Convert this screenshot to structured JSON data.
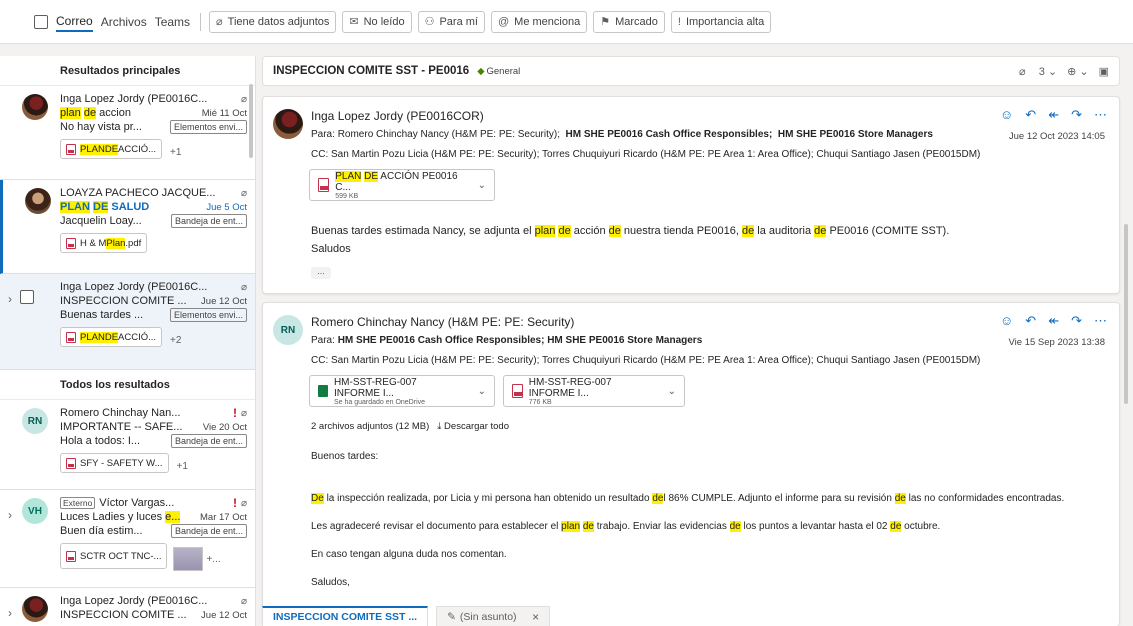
{
  "filterbar": {
    "tabs": [
      "Correo",
      "Archivos",
      "Teams"
    ],
    "chips": [
      {
        "icon": "paperclip-icon",
        "glyph": "⌀",
        "label": "Tiene datos adjuntos"
      },
      {
        "icon": "unread-mail-icon",
        "glyph": "✉",
        "label": "No leído"
      },
      {
        "icon": "person-icon",
        "glyph": "⚇",
        "label": "Para mí"
      },
      {
        "icon": "at-mention-icon",
        "glyph": "@",
        "label": "Me menciona"
      },
      {
        "icon": "flag-icon",
        "glyph": "⚑",
        "label": "Marcado"
      },
      {
        "icon": "importance-icon",
        "glyph": "!",
        "label": "Importancia alta"
      }
    ]
  },
  "list": {
    "top_header": "Resultados principales",
    "all_header": "Todos los resultados",
    "items": [
      {
        "sender": "Inga Lopez Jordy (PE0016C...",
        "subj_a": "plan",
        "subj_b": " ",
        "subj_c": "de",
        "subj_d": " accion",
        "date": "Mié 11 Oct",
        "preview": "No hay vista pr...",
        "folder": "Elementos envi...",
        "att_a": "PLAN",
        "att_b": " ",
        "att_c": "DE",
        "att_d": " ACCIÓ...",
        "more": "+1"
      },
      {
        "sender": "LOAYZA PACHECO JACQUE...",
        "subj_a": "PLAN",
        "subj_b": " ",
        "subj_c": "DE",
        "subj_d": " SALUD",
        "date": "Jue 5 Oct",
        "preview": "Jacquelin Loay...",
        "folder": "Bandeja de ent...",
        "att_a": "H & M ",
        "att_b": "Plan",
        "att_c": ".pdf"
      },
      {
        "sender": "Inga Lopez Jordy (PE0016C...",
        "subject": "INSPECCION COMITE ...",
        "date": "Jue 12 Oct",
        "preview": "Buenas tardes ...",
        "folder": "Elementos envi...",
        "att_a": "PLAN",
        "att_b": " ",
        "att_c": "DE",
        "att_d": " ACCIÓ...",
        "more": "+2"
      },
      {
        "initials": "RN",
        "sender": "Romero Chinchay Nan...",
        "subject": "IMPORTANTE -- SAFE...",
        "date": "Vie 20 Oct",
        "preview": "Hola a todos: I...",
        "folder": "Bandeja de ent...",
        "att": "SFY - SAFETY W...",
        "more": "+1"
      },
      {
        "initials": "VH",
        "external": "Externo",
        "sender": "Víctor Vargas...",
        "subj_a": "Luces Ladies y luces ",
        "subj_b": "e...",
        "date": "Mar 17 Oct",
        "preview": "Buen día estim...",
        "folder": "Bandeja de ent...",
        "att": "SCTR OCT TNC-...",
        "more": "+..."
      },
      {
        "sender": "Inga Lopez Jordy (PE0016C...",
        "subject": "INSPECCION COMITE ...",
        "date": "Jue 12 Oct"
      }
    ]
  },
  "reading": {
    "subject": "INSPECCION COMITE SST - PE0016",
    "channel": "General",
    "count": "3",
    "msg1": {
      "sender": "Inga Lopez Jordy (PE0016COR)",
      "to_label": "Para:",
      "to": "Romero Chinchay Nancy (H&M PE: PE: Security);",
      "to_b1": "HM SHE PE0016 Cash Office Responsibles;",
      "to_b2": "HM SHE PE0016 Store Managers",
      "cc": "CC:  San Martin Pozu Licia (H&M PE: PE: Security);  Torres Chuquiyuri Ricardo (H&M PE: PE Area 1: Area Office);  Chuqui Santiago Jasen (PE0015DM)",
      "timestamp": "Jue 12 Oct 2023 14:05",
      "att_a": "PLAN",
      "att_b": " ",
      "att_c": "DE",
      "att_d": " ACCIÓN PE0016 C...",
      "att_size": "599 KB",
      "body1_a": "Buenas tardes estimada Nancy, se adjunta el ",
      "body1_b": "plan",
      "body1_c": " ",
      "body1_d": "de",
      "body1_e": " acción ",
      "body1_f": "de",
      "body1_g": " nuestra tienda PE0016, ",
      "body1_h": "de",
      "body1_i": " la auditoria ",
      "body1_j": "de",
      "body1_k": " PE0016 (COMITE SST).",
      "body2": "Saludos",
      "ellipsis": "..."
    },
    "msg2": {
      "initials": "RN",
      "sender": "Romero Chinchay Nancy (H&M PE: PE: Security)",
      "to_label": "Para:",
      "to_b": "HM SHE PE0016 Cash Office Responsibles;  HM SHE PE0016 Store Managers",
      "cc": "CC:  San Martin Pozu Licia (H&M PE: PE: Security);  Torres Chuquiyuri Ricardo (H&M PE: PE Area 1: Area Office);  Chuqui Santiago Jasen (PE0015DM)",
      "timestamp": "Vie 15 Sep 2023 13:38",
      "att1": "HM-SST-REG-007 INFORME I...",
      "att1_sub": "Se ha guardado en OneDrive",
      "att2": "HM-SST-REG-007 INFORME I...",
      "att2_sub": "776 KB",
      "att_summary": "2 archivos adjuntos (12 MB)",
      "download_all": "Descargar todo",
      "greeting": "Buenos tardes:",
      "p1_a": "De",
      "p1_b": " la inspección realizada, por Licia y mi persona han obtenido un resultado ",
      "p1_c": "de",
      "p1_d": "l 86% CUMPLE. Adjunto el informe para su revisión ",
      "p1_e": "de",
      "p1_f": " las no conformidades encontradas.",
      "p2_a": "Les agradeceré revisar el documento para establecer  el ",
      "p2_b": "plan",
      "p2_c": " ",
      "p2_d": "de",
      "p2_e": " trabajo. Enviar las evidencias ",
      "p2_f": "de",
      "p2_g": " los puntos a levantar hasta el 02 ",
      "p2_h": "de",
      "p2_i": " octubre.",
      "p3": "En caso tengan alguna duda nos comentan.",
      "p4": "Saludos,"
    }
  },
  "bottom_tabs": {
    "tab1": "INSPECCION COMITE SST ...",
    "tab2": "(Sin asunto)"
  },
  "colors": {
    "accent": "#0f6cbd",
    "highlight": "#ffef00",
    "important": "#c50f1f"
  }
}
